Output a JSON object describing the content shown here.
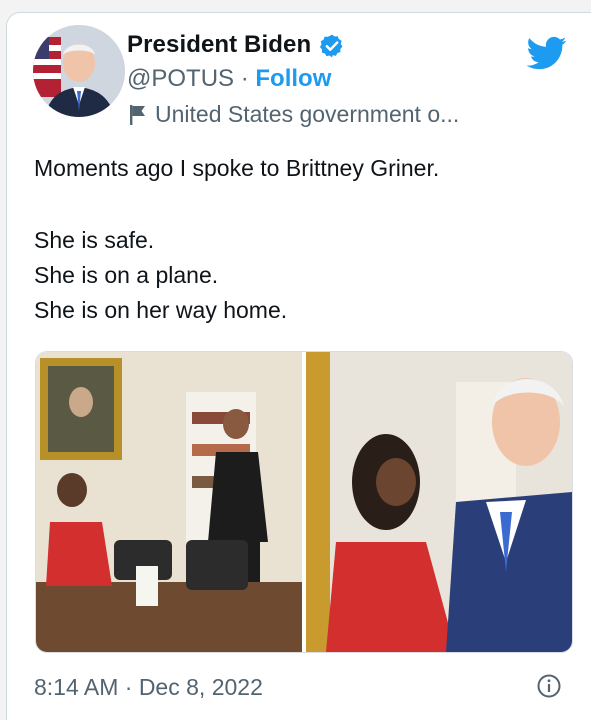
{
  "tweet": {
    "author_name": "President Biden",
    "handle": "@POTUS",
    "separator": " · ",
    "follow_label": "Follow",
    "account_label": "United States government o...",
    "lines": [
      "Moments ago I spoke to Brittney Griner.",
      "She is safe.",
      "She is on a plane.",
      "She is on her way home."
    ],
    "timestamp": "8:14 AM · Dec 8, 2022"
  },
  "icons": {
    "verified": "verified-badge-icon",
    "twitter": "twitter-bird-icon",
    "flag": "government-flag-icon",
    "info": "info-icon"
  },
  "colors": {
    "accent": "#1d9bf0",
    "secondary_text": "#536471",
    "primary_text": "#0f1419"
  }
}
